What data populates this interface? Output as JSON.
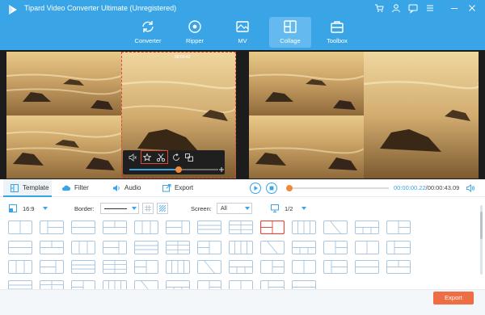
{
  "window": {
    "title": "Tipard Video Converter Ultimate (Unregistered)",
    "controls": [
      "cart-icon",
      "user-icon",
      "chat-icon",
      "menu-icon",
      "minimize-icon",
      "close-icon"
    ]
  },
  "nav": {
    "items": [
      {
        "label": "Converter",
        "icon": "converter-icon"
      },
      {
        "label": "Ripper",
        "icon": "ripper-icon"
      },
      {
        "label": "MV",
        "icon": "mv-icon"
      },
      {
        "label": "Collage",
        "icon": "collage-icon",
        "active": true
      },
      {
        "label": "Toolbox",
        "icon": "toolbox-icon"
      }
    ]
  },
  "preview": {
    "timecode": "00:00:42",
    "edit_progress": 0.55
  },
  "tabs": {
    "items": [
      {
        "label": "Template",
        "icon": "template-icon",
        "active": true
      },
      {
        "label": "Filter",
        "icon": "filter-icon"
      },
      {
        "label": "Audio",
        "icon": "audio-icon"
      },
      {
        "label": "Export",
        "icon": "export-icon"
      }
    ]
  },
  "playback": {
    "current_time": "00:00:00.22",
    "total_time": "/00:00:43.09",
    "progress": 0.005
  },
  "options": {
    "aspect_ratio": "16:9",
    "border_label": "Border:",
    "screen_label": "Screen:",
    "screen_value": "All",
    "page": "1/2"
  },
  "templates": {
    "count": 49,
    "selected_index": 8
  },
  "footer": {
    "export_label": "Export"
  },
  "colors": {
    "header": "#3aa5e6",
    "accent": "#3aa5e6",
    "selection": "#e0483c",
    "export_button": "#ef6d43"
  }
}
